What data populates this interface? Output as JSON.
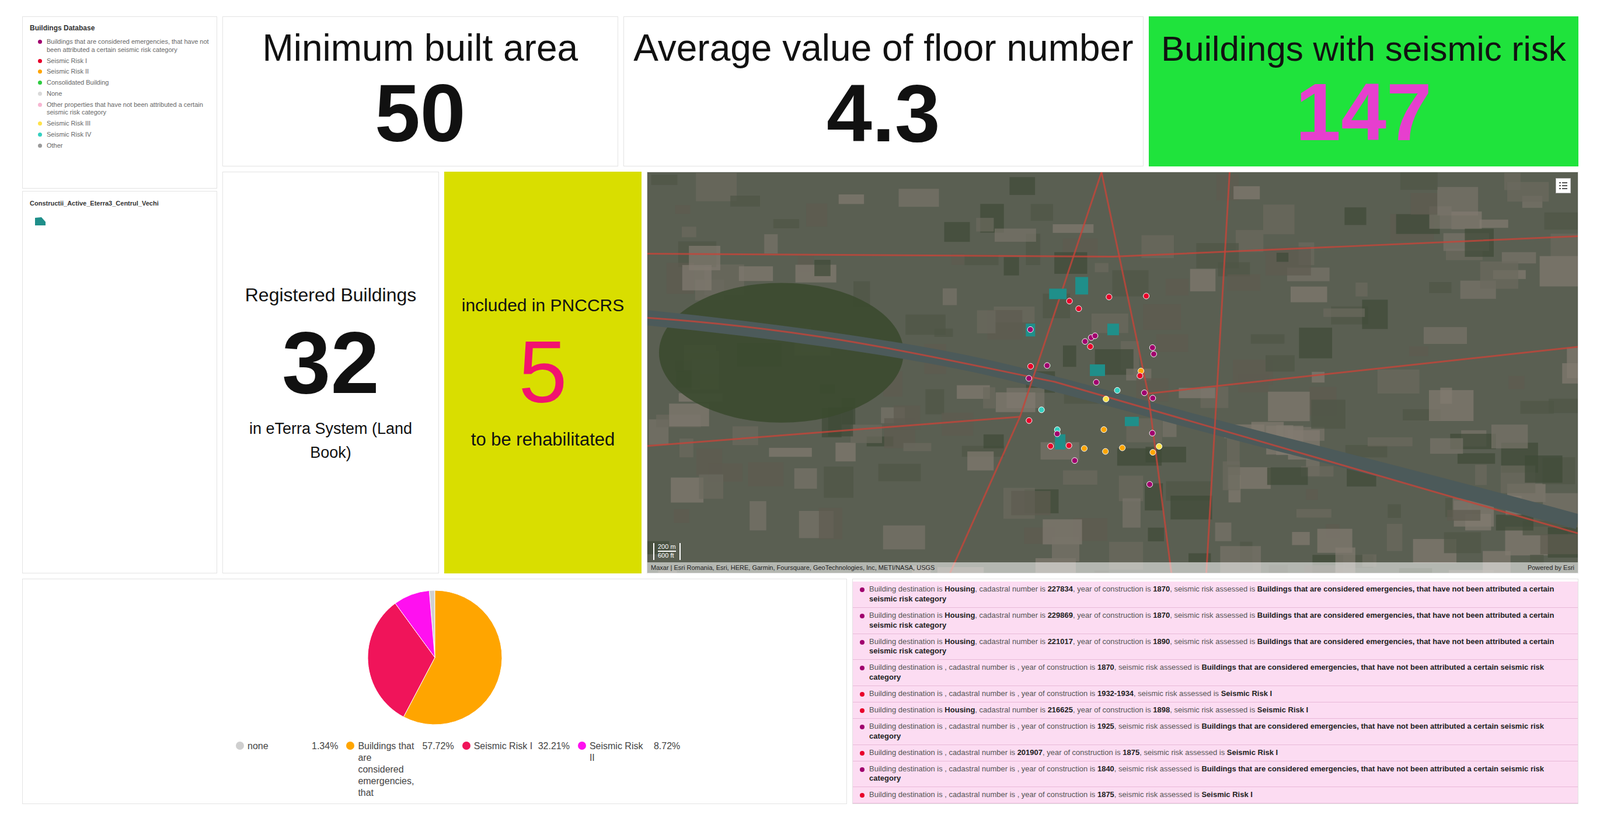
{
  "legend": {
    "title": "Buildings Database",
    "items": [
      {
        "label": "Buildings that are considered emergencies, that have not been attributed a certain seismic risk category",
        "color": "#a0006e"
      },
      {
        "label": "Seismic Risk I",
        "color": "#e8002a"
      },
      {
        "label": "Seismic Risk II",
        "color": "#ffa500"
      },
      {
        "label": "Consolidated Building",
        "color": "#2ecc40"
      },
      {
        "label": "None",
        "color": "#d9d9d9"
      },
      {
        "label": "Other properties that have not been attributed a certain seismic risk category",
        "color": "#f7b6d2"
      },
      {
        "label": "Seismic Risk III",
        "color": "#ffe24a"
      },
      {
        "label": "Seismic Risk IV",
        "color": "#35d0c0"
      },
      {
        "label": "Other",
        "color": "#9a9a9a"
      }
    ]
  },
  "layer": {
    "title": "Constructii_Active_Eterra3_Centrul_Vechi",
    "color": "#1f8f8a"
  },
  "kpis": [
    {
      "title": "Minimum built area",
      "value": "50",
      "kind": "plain"
    },
    {
      "title": "Average value of floor number",
      "value": "4.3",
      "kind": "plain"
    },
    {
      "title": "Buildings with seismic risk",
      "value": "147",
      "kind": "alert"
    }
  ],
  "registered": {
    "top": "Registered Buildings",
    "value": "32",
    "bottom": "in eTerra System (Land Book)"
  },
  "pnccrs": {
    "top": "included in PNCCRS",
    "value": "5",
    "bottom": "to be rehabilitated"
  },
  "map": {
    "scale_m": "200 m",
    "scale_ft": "600 ft",
    "attribution": "Maxar | Esri Romania, Esri, HERE, Garmin, Foursquare, GeoTechnologies, Inc, METI/NASA, USGS",
    "powered": "Powered by Esri",
    "pins": [
      {
        "color": "#a0006e"
      },
      {
        "color": "#e8002a"
      },
      {
        "color": "#ffa500"
      },
      {
        "color": "#a0006e"
      },
      {
        "color": "#e8002a"
      },
      {
        "color": "#35d0c0"
      },
      {
        "color": "#a0006e"
      },
      {
        "color": "#ffa500"
      },
      {
        "color": "#e8002a"
      },
      {
        "color": "#a0006e"
      },
      {
        "color": "#ffe24a"
      },
      {
        "color": "#a0006e"
      },
      {
        "color": "#e8002a"
      },
      {
        "color": "#a0006e"
      },
      {
        "color": "#ffa500"
      },
      {
        "color": "#e8002a"
      },
      {
        "color": "#a0006e"
      },
      {
        "color": "#35d0c0"
      },
      {
        "color": "#a0006e"
      },
      {
        "color": "#e8002a"
      },
      {
        "color": "#ffa500"
      },
      {
        "color": "#a0006e"
      },
      {
        "color": "#e8002a"
      },
      {
        "color": "#a0006e"
      },
      {
        "color": "#ffe24a"
      },
      {
        "color": "#a0006e"
      },
      {
        "color": "#e8002a"
      },
      {
        "color": "#ffa500"
      },
      {
        "color": "#a0006e"
      },
      {
        "color": "#e8002a"
      },
      {
        "color": "#a0006e"
      },
      {
        "color": "#35d0c0"
      },
      {
        "color": "#e8002a"
      },
      {
        "color": "#a0006e"
      },
      {
        "color": "#ffa500"
      },
      {
        "color": "#a0006e"
      }
    ]
  },
  "pie": {
    "slices": [
      {
        "label": "none",
        "percent": "1.34%",
        "value": 1.34,
        "color": "#cfcfcf"
      },
      {
        "label": "Buildings that are considered emergencies, that",
        "percent": "57.72%",
        "value": 57.72,
        "color": "#ffa500"
      },
      {
        "label": "Seismic Risk I",
        "percent": "32.21%",
        "value": 32.21,
        "color": "#f0145a"
      },
      {
        "label": "Seismic Risk II",
        "percent": "8.72%",
        "value": 8.72,
        "color": "#ff10f0"
      }
    ]
  },
  "list": {
    "labels": [
      "Building destination is ",
      ", cadastral number is ",
      ", year of construction is ",
      ", seismic risk assessed is "
    ],
    "rows": [
      {
        "destination": "Housing",
        "cadastral": "227834",
        "year": "1870",
        "risk": "Buildings that are considered emergencies, that have not been attributed a certain seismic risk category",
        "color": "#a0006e"
      },
      {
        "destination": "Housing",
        "cadastral": "229869",
        "year": "1870",
        "risk": "Buildings that are considered emergencies, that have not been attributed a certain seismic risk category",
        "color": "#a0006e"
      },
      {
        "destination": "Housing",
        "cadastral": "221017",
        "year": "1890",
        "risk": "Buildings that are considered emergencies, that have not been attributed a certain seismic risk category",
        "color": "#a0006e"
      },
      {
        "destination": "",
        "cadastral": "",
        "year": "1870",
        "risk": "Buildings that are considered emergencies, that have not been attributed a certain seismic risk category",
        "color": "#a0006e"
      },
      {
        "destination": "",
        "cadastral": "",
        "year": "1932-1934",
        "risk": "Seismic Risk I",
        "color": "#e8002a"
      },
      {
        "destination": "Housing",
        "cadastral": "216625",
        "year": "1898",
        "risk": "Seismic Risk I",
        "color": "#e8002a"
      },
      {
        "destination": "",
        "cadastral": "",
        "year": "1925",
        "risk": "Buildings that are considered emergencies, that have not been attributed a certain seismic risk category",
        "color": "#a0006e"
      },
      {
        "destination": "",
        "cadastral": "201907",
        "year": "1875",
        "risk": "Seismic Risk I",
        "color": "#e8002a"
      },
      {
        "destination": "",
        "cadastral": "",
        "year": "1840",
        "risk": "Buildings that are considered emergencies, that have not been attributed a certain seismic risk category",
        "color": "#a0006e"
      },
      {
        "destination": "",
        "cadastral": "",
        "year": "1875",
        "risk": "Seismic Risk I",
        "color": "#e8002a"
      }
    ]
  }
}
